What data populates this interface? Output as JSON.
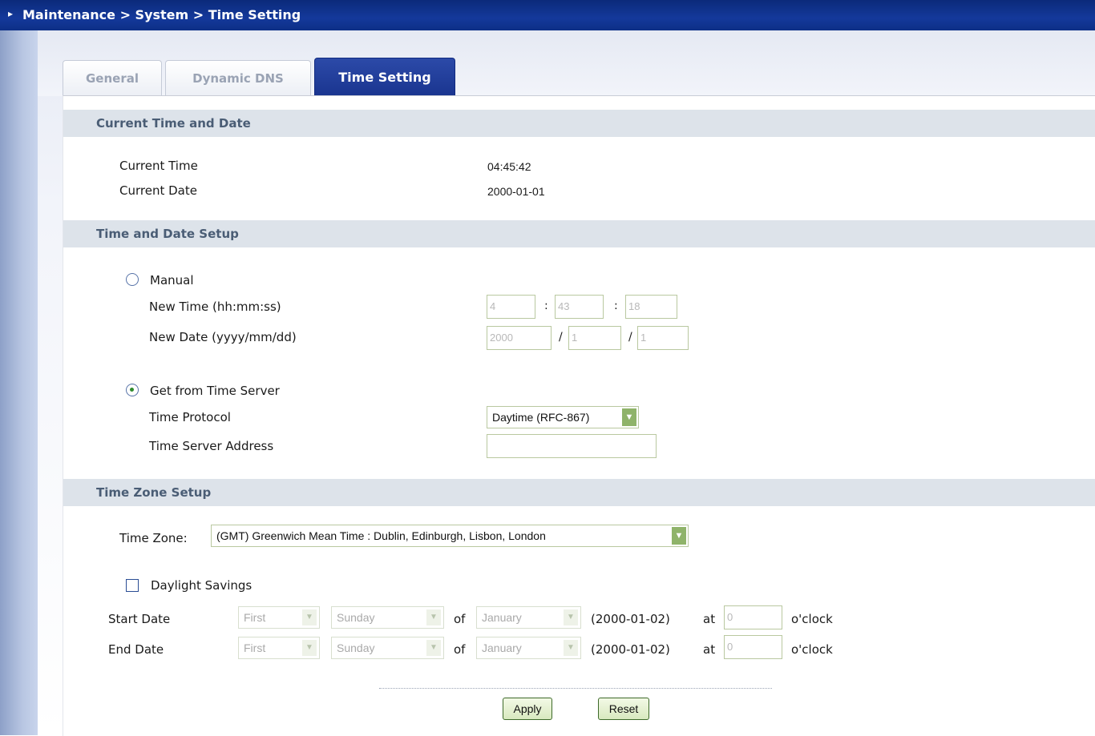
{
  "breadcrumb": "Maintenance > System > Time Setting",
  "tabs": [
    {
      "label": "General"
    },
    {
      "label": "Dynamic DNS"
    },
    {
      "label": "Time Setting"
    }
  ],
  "current": {
    "header": "Current Time and Date",
    "time_label": "Current Time",
    "time_value": "04:45:42",
    "date_label": "Current Date",
    "date_value": "2000-01-01"
  },
  "setup": {
    "header": "Time and Date Setup",
    "manual_label": "Manual",
    "new_time_label": "New Time (hh:mm:ss)",
    "new_time": {
      "h": "4",
      "m": "43",
      "s": "18"
    },
    "new_date_label": "New Date (yyyy/mm/dd)",
    "new_date": {
      "y": "2000",
      "m": "1",
      "d": "1"
    },
    "colon": ":",
    "slash": "/",
    "server_label": "Get from Time Server",
    "protocol_label": "Time Protocol",
    "protocol_value": "Daytime (RFC-867)",
    "address_label": "Time Server Address",
    "address_value": ""
  },
  "zone": {
    "header": "Time Zone Setup",
    "tz_label": "Time Zone:",
    "tz_value": "(GMT) Greenwich Mean Time : Dublin, Edinburgh, Lisbon, London",
    "dst_label": "Daylight Savings",
    "start_label": "Start Date",
    "end_label": "End Date",
    "rows": {
      "start": {
        "week": "First",
        "day": "Sunday",
        "of": "of",
        "month": "January",
        "date": "(2000-01-02)",
        "at": "at",
        "hour": "0",
        "oclock": "o'clock"
      },
      "end": {
        "week": "First",
        "day": "Sunday",
        "of": "of",
        "month": "January",
        "date": "(2000-01-02)",
        "at": "at",
        "hour": "0",
        "oclock": "o'clock"
      }
    }
  },
  "buttons": {
    "apply": "Apply",
    "reset": "Reset"
  },
  "colors": {
    "header_bg": "#14399b",
    "section_bg": "#dde3ea",
    "accent_green": "#8fb36a"
  }
}
